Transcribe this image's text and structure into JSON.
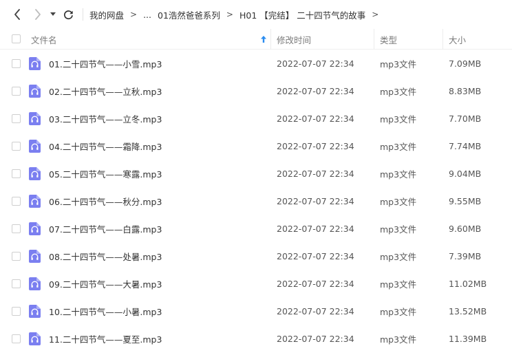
{
  "breadcrumb": [
    {
      "label": "我的网盘"
    },
    {
      "label": "..."
    },
    {
      "label": "01浩然爸爸系列"
    },
    {
      "label": "H01 【完结】 二十四节气的故事"
    }
  ],
  "header": {
    "name": "文件名",
    "modified": "修改时间",
    "type": "类型",
    "size": "大小"
  },
  "files": [
    {
      "name": "01.二十四节气——小雪.mp3",
      "modified": "2022-07-07 22:34",
      "type": "mp3文件",
      "size": "7.09MB"
    },
    {
      "name": "02.二十四节气——立秋.mp3",
      "modified": "2022-07-07 22:34",
      "type": "mp3文件",
      "size": "8.83MB"
    },
    {
      "name": "03.二十四节气——立冬.mp3",
      "modified": "2022-07-07 22:34",
      "type": "mp3文件",
      "size": "7.70MB"
    },
    {
      "name": "04.二十四节气——霜降.mp3",
      "modified": "2022-07-07 22:34",
      "type": "mp3文件",
      "size": "7.74MB"
    },
    {
      "name": "05.二十四节气——寒露.mp3",
      "modified": "2022-07-07 22:34",
      "type": "mp3文件",
      "size": "9.04MB"
    },
    {
      "name": "06.二十四节气——秋分.mp3",
      "modified": "2022-07-07 22:34",
      "type": "mp3文件",
      "size": "9.55MB"
    },
    {
      "name": "07.二十四节气——白露.mp3",
      "modified": "2022-07-07 22:34",
      "type": "mp3文件",
      "size": "9.60MB"
    },
    {
      "name": "08.二十四节气——处暑.mp3",
      "modified": "2022-07-07 22:34",
      "type": "mp3文件",
      "size": "7.39MB"
    },
    {
      "name": "09.二十四节气——大暑.mp3",
      "modified": "2022-07-07 22:34",
      "type": "mp3文件",
      "size": "11.02MB"
    },
    {
      "name": "10.二十四节气——小暑.mp3",
      "modified": "2022-07-07 22:34",
      "type": "mp3文件",
      "size": "13.52MB"
    },
    {
      "name": "11.二十四节气——夏至.mp3",
      "modified": "2022-07-07 22:34",
      "type": "mp3文件",
      "size": "11.39MB"
    }
  ],
  "icons": {
    "file": "headphones-icon",
    "sort": "arrow-up-icon"
  },
  "colors": {
    "file_icon": "#7b7ff0",
    "sort_arrow": "#2a8cf0"
  }
}
